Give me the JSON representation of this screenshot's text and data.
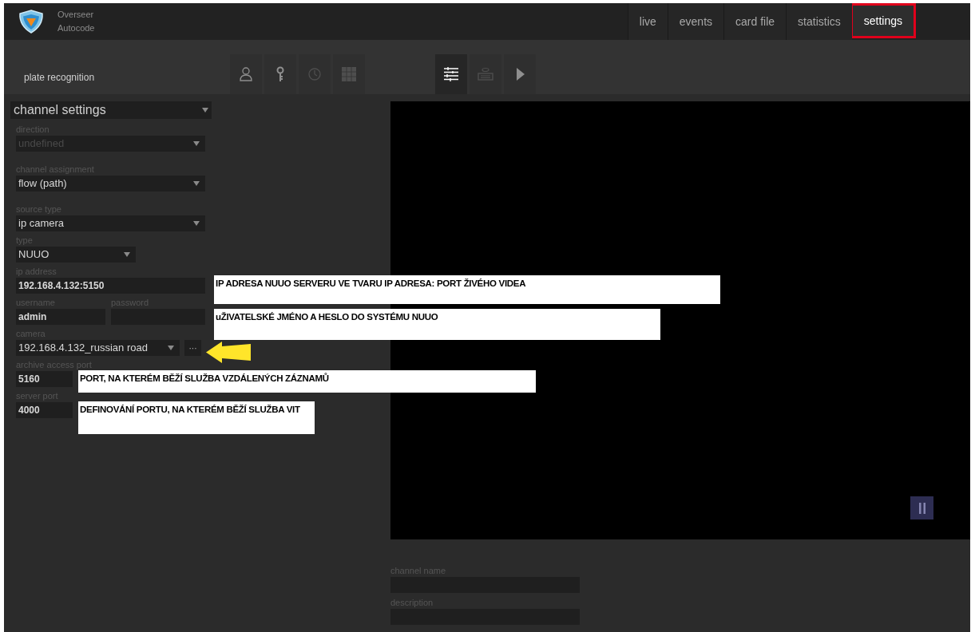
{
  "app": {
    "name_lines": [
      "Overseer",
      "Autocode"
    ]
  },
  "nav": [
    {
      "label": "live",
      "selected": false,
      "highlighted": false
    },
    {
      "label": "events",
      "selected": false,
      "highlighted": false
    },
    {
      "label": "card file",
      "selected": false,
      "highlighted": false
    },
    {
      "label": "statistics",
      "selected": false,
      "highlighted": false
    },
    {
      "label": "settings",
      "selected": true,
      "highlighted": true
    }
  ],
  "module_title": "plate recognition",
  "toolbar": [
    [
      {
        "kind": "person",
        "selected": false,
        "disabled": false
      },
      {
        "kind": "key",
        "selected": false,
        "disabled": false
      },
      {
        "kind": "clock",
        "selected": false,
        "disabled": true
      },
      {
        "kind": "grid",
        "selected": false,
        "disabled": true
      }
    ],
    [
      {
        "kind": "list",
        "selected": true,
        "disabled": false
      },
      {
        "kind": "keyboard",
        "selected": false,
        "disabled": true
      },
      {
        "kind": "play",
        "selected": false,
        "disabled": false
      }
    ]
  ],
  "section_select": "channel settings",
  "fields": [
    {
      "kind": "select",
      "label": "direction",
      "value": "undefined",
      "disabled": true
    },
    {
      "kind": "select",
      "label": "channel assignment",
      "value": "flow (path)",
      "disabled": false
    },
    {
      "kind": "select",
      "label": "source type",
      "value": "ip camera",
      "disabled": false
    },
    {
      "kind": "short-select",
      "label": "type",
      "value": "NUUO",
      "disabled": false
    },
    {
      "kind": "text",
      "label": "ip address",
      "value": "192.168.4.132:5150"
    },
    {
      "kind": "pair",
      "label": "username",
      "value": "admin",
      "label2": "password"
    },
    {
      "kind": "camera",
      "label": "camera",
      "value": "192.168.4.132_russian road",
      "button": "···"
    },
    {
      "kind": "short-text",
      "label": "archive access port",
      "value": "5160"
    },
    {
      "kind": "short-text",
      "label": "server port",
      "value": "4000"
    }
  ],
  "annotations": [
    {
      "text": "IP ADRESA NUUO SERVERU VE TVARU IP ADRESA: PORT ŽIVÉHO VIDEA"
    },
    {
      "text": "uŽIVATELSKÉ JMÉNO A HESLO DO SYSTÉMU NUUO"
    },
    {
      "text": "PORT, NA KTERÉM BĚŽÍ SLUŽBA VZDÁLENÝCH ZÁZNAMŮ"
    },
    {
      "text": "DEFINOVÁNÍ PORTU, NA KTERÉM BĚŽÍ SLUŽBA VIT"
    }
  ],
  "video": {
    "paused": false
  },
  "bottom_fields": [
    {
      "label": "channel name"
    },
    {
      "label": "description"
    }
  ]
}
